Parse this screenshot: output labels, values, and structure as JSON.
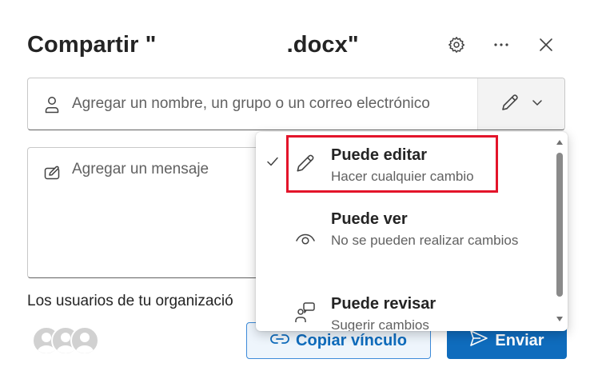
{
  "header": {
    "title": "Compartir \"                    .docx\"",
    "settings_icon": "gear-icon",
    "more_icon": "more-horizontal-icon",
    "close_icon": "close-icon"
  },
  "people_field": {
    "placeholder": "Agregar un nombre, un grupo o un correo electrónico",
    "icon": "person-icon",
    "permission_icon": "pencil-icon",
    "dropdown_icon": "chevron-down-icon"
  },
  "message_field": {
    "placeholder": "Agregar un mensaje",
    "icon": "compose-icon"
  },
  "org_note": "Los usuarios de tu organizació",
  "permission_menu": {
    "items": [
      {
        "title": "Puede editar",
        "description": "Hacer cualquier cambio",
        "icon": "pencil-icon",
        "selected": true
      },
      {
        "title": "Puede ver",
        "description": "No se pueden realizar cambios",
        "icon": "eye-icon",
        "selected": false
      },
      {
        "title": "Puede revisar",
        "description": "Sugerir cambios",
        "icon": "review-icon",
        "selected": false
      }
    ],
    "highlight_color": "#e3142a"
  },
  "buttons": {
    "copy_link_label": "Copiar vínculo",
    "send_label": "Enviar"
  },
  "colors": {
    "accent": "#0f6cbd",
    "accent_light": "#eef5fc",
    "text": "#242424",
    "muted_text": "#616161"
  }
}
